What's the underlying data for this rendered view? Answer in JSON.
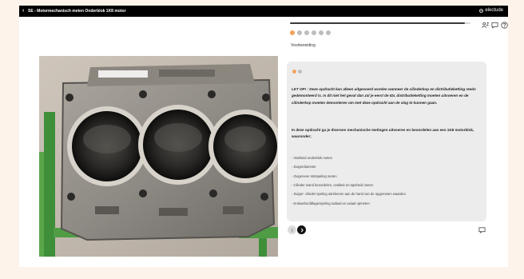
{
  "topbar": {
    "back_icon": "chevron-left-icon",
    "title": "SE - Motormechanisch meten Onderblok 1K8 motor",
    "brand_icon": "electude-logo-icon",
    "brand": "electude"
  },
  "image": {
    "subject": "engine-block-photo"
  },
  "progress": {
    "fraction": 0.97,
    "dots_total": 6,
    "active_dot": 0
  },
  "tools": [
    "user-switch-icon",
    "chat-icon",
    "help-icon"
  ],
  "step_label": "Voorbereiding",
  "card": {
    "dots_total": 2,
    "active_dot": 0,
    "note": "LET OP! : Deze opdracht kan alleen uitgevoerd worden wanneer de cilinderkop en distributieketting reeds gedemonteerd is. Is dit niet het geval dan zal je eerst de IDL distributieketting moeten uitvoeren en de cilinderkop moeten demonteren om met deze opdracht aan de slag te kunnen gaan.",
    "intro": "In deze opdracht ga je diversen mechanische metingen uitvoeren en beoordelen aan een 1K8 motorblok, waaronder;",
    "items": [
      "- Vlakheid onderblok meten",
      "- Zuigerdiameter",
      "- Zuigerveer stotspeling meten",
      "- Cilinder wand beoordelen, ovaliteit en tapsheid meten",
      "- Zuiger- cilinder speling uitrekenen aan de hand van de opgemeten waarden",
      "- Krukashoofdlagerspeling radiaal en axiaal opmeten"
    ]
  },
  "nav": {
    "prev_icon": "chevron-left-icon",
    "next_icon": "chevron-right-icon",
    "chat_icon": "comment-icon"
  },
  "colors": {
    "accent": "#f5a25b",
    "topbar": "#000000",
    "card": "#ececec",
    "backdrop": "#fdf3ea"
  }
}
